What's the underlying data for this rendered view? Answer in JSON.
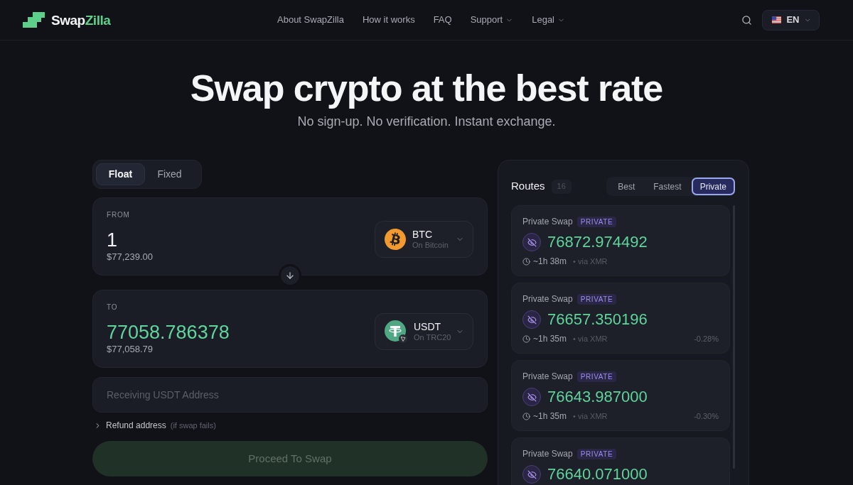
{
  "header": {
    "brand": {
      "lead": "Swap",
      "accent": "Zilla"
    },
    "nav": [
      {
        "label": "About SwapZilla",
        "has_menu": false
      },
      {
        "label": "How it works",
        "has_menu": false
      },
      {
        "label": "FAQ",
        "has_menu": false
      },
      {
        "label": "Support",
        "has_menu": true
      },
      {
        "label": "Legal",
        "has_menu": true
      }
    ],
    "language": {
      "code": "EN"
    }
  },
  "hero": {
    "title": "Swap crypto at the best rate",
    "subtitle": "No sign-up. No verification. Instant exchange."
  },
  "swap": {
    "modes": [
      {
        "label": "Float",
        "selected": true
      },
      {
        "label": "Fixed",
        "selected": false
      }
    ],
    "from": {
      "label": "FROM",
      "amount": "1",
      "fiat": "$77,239.00",
      "token": {
        "symbol": "BTC",
        "network": "On Bitcoin",
        "kind": "bitcoin"
      }
    },
    "to": {
      "label": "TO",
      "amount": "77058.786378",
      "fiat": "$77,058.79",
      "token": {
        "symbol": "USDT",
        "network": "On TRC20",
        "kind": "tether"
      }
    },
    "address": {
      "placeholder": "Receiving USDT Address"
    },
    "refund": {
      "label": "Refund address",
      "hint": "(if swap fails)",
      "expanded": false
    },
    "proceed": {
      "label": "Proceed To Swap",
      "disabled": true
    }
  },
  "routes": {
    "title": "Routes",
    "count": "16",
    "filters": [
      {
        "label": "Best",
        "selected": false
      },
      {
        "label": "Fastest",
        "selected": false
      },
      {
        "label": "Private",
        "selected": true
      }
    ],
    "items": [
      {
        "name": "Private Swap",
        "badge": "PRIVATE",
        "amount": "76872.974492",
        "eta": "~1h 38m",
        "via": "• via XMR"
      },
      {
        "name": "Private Swap",
        "badge": "PRIVATE",
        "amount": "76657.350196",
        "eta": "~1h 35m",
        "via": "• via XMR",
        "delta": "-0.28%"
      },
      {
        "name": "Private Swap",
        "badge": "PRIVATE",
        "amount": "76643.987000",
        "eta": "~1h 35m",
        "via": "• via XMR",
        "delta": "-0.30%"
      },
      {
        "name": "Private Swap",
        "badge": "PRIVATE",
        "amount": "76640.071000"
      }
    ]
  }
}
